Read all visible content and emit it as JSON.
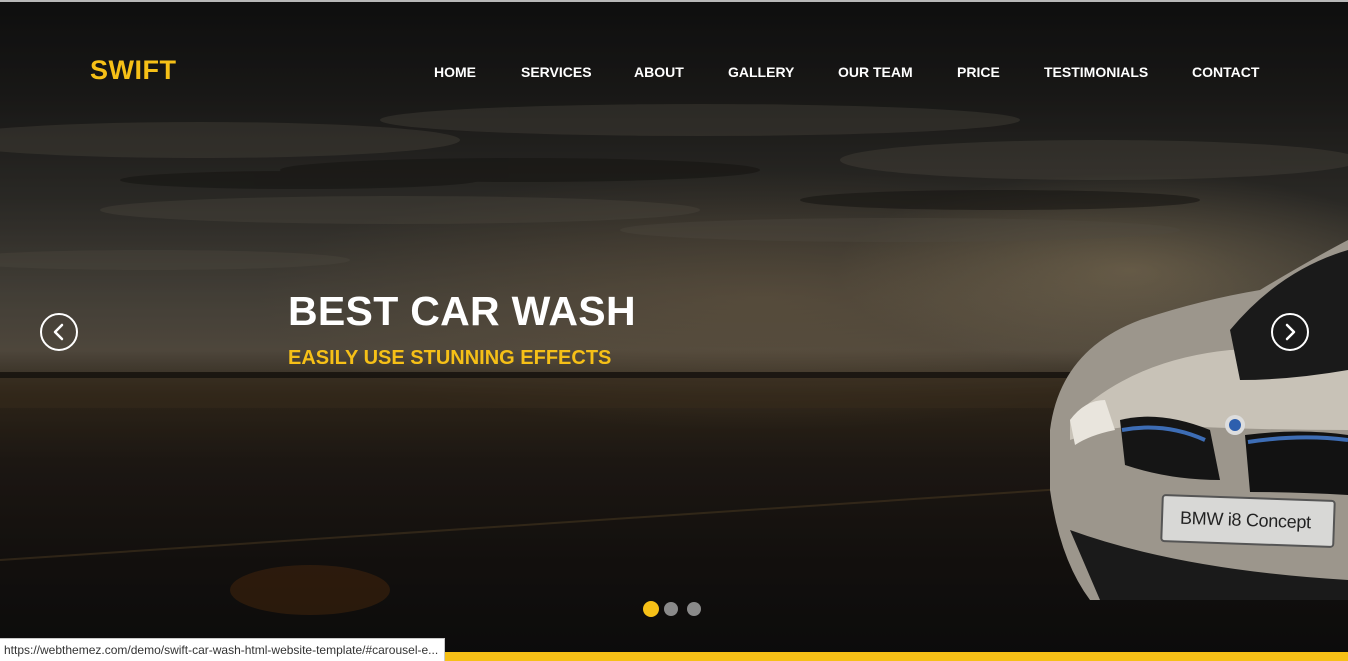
{
  "brand": {
    "logo_text": "SWIFT"
  },
  "nav": {
    "items": [
      {
        "label": "HOME"
      },
      {
        "label": "SERVICES"
      },
      {
        "label": "ABOUT"
      },
      {
        "label": "GALLERY"
      },
      {
        "label": "OUR TEAM"
      },
      {
        "label": "PRICE"
      },
      {
        "label": "TESTIMONIALS"
      },
      {
        "label": "CONTACT"
      }
    ]
  },
  "hero": {
    "headline": "BEST CAR WASH",
    "subheadline": "EASILY USE STUNNING EFFECTS",
    "car_plate_text": "BMW i8 Concept",
    "prev_icon": "chevron-left-circle-icon",
    "next_icon": "chevron-right-circle-icon"
  },
  "carousel": {
    "slide_count": 3,
    "active_index": 0
  },
  "status_bar": {
    "url": "https://webthemez.com/demo/swift-car-wash-html-website-template/#carousel-e..."
  },
  "colors": {
    "accent": "#f6c017",
    "nav_text": "#ffffff",
    "dot_inactive": "#8a8a8a"
  }
}
